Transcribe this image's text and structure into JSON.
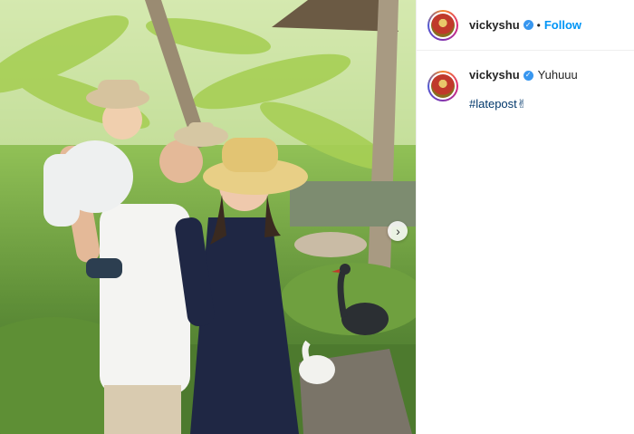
{
  "post": {
    "author": {
      "username": "vickyshu",
      "verified": true,
      "follow_label": "Follow",
      "separator": "•"
    },
    "caption": {
      "username": "vickyshu",
      "text": "Yuhuuu",
      "hashtag": "#latepost✌"
    },
    "carousel": {
      "next_icon": "chevron-right-icon",
      "next_glyph": "›"
    }
  },
  "colors": {
    "follow": "#0095f6",
    "verified": "#3897f0",
    "hashtag": "#00376b"
  }
}
